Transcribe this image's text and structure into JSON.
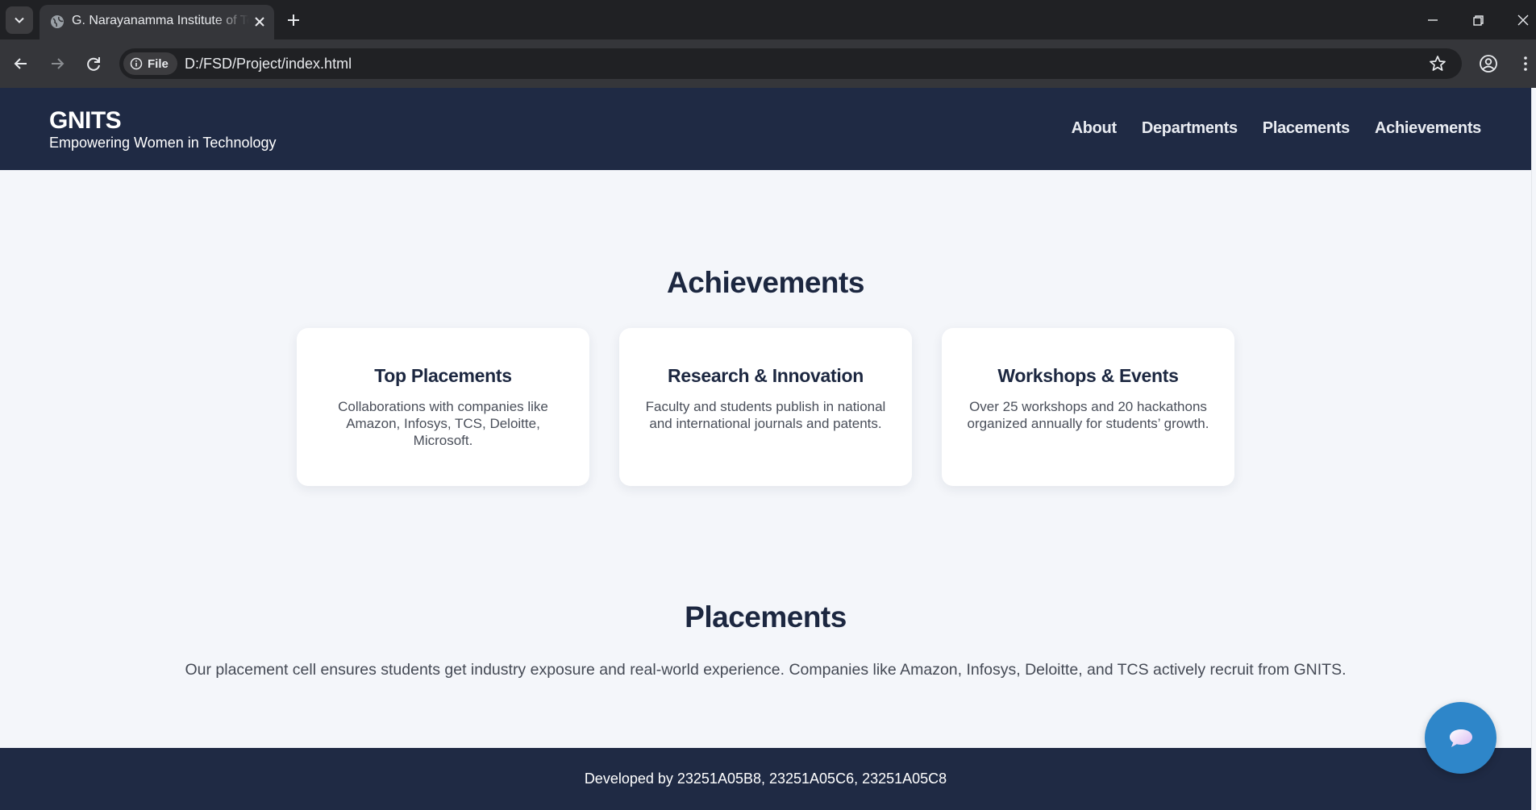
{
  "browser": {
    "tab_title": "G. Narayanamma Institute of Technology",
    "chip_label": "File",
    "url": "D:/FSD/Project/index.html"
  },
  "site": {
    "brand_name": "GNITS",
    "tagline": "Empowering Women in Technology",
    "nav": [
      "About",
      "Departments",
      "Placements",
      "Achievements"
    ]
  },
  "achievements": {
    "title": "Achievements",
    "cards": [
      {
        "title": "Top Placements",
        "text": "Collaborations with companies like Amazon, Infosys, TCS, Deloitte, Microsoft."
      },
      {
        "title": "Research & Innovation",
        "text": "Faculty and students publish in national and international journals and patents."
      },
      {
        "title": "Workshops & Events",
        "text": "Over 25 workshops and 20 hackathons organized annually for students’ growth."
      }
    ]
  },
  "placements": {
    "title": "Placements",
    "text": "Our placement cell ensures students get industry exposure and real-world experience. Companies like Amazon, Infosys, Deloitte, and TCS actively recruit from GNITS."
  },
  "footer": {
    "text": "Developed by 23251A05B8, 23251A05C6, 23251A05C8"
  },
  "colors": {
    "header_bg": "#1f2a44",
    "page_bg": "#f4f6fa",
    "chat_button": "#2e86c9"
  },
  "icons": [
    "tab-search-icon",
    "globe-icon",
    "close-icon",
    "plus-icon",
    "minimize-icon",
    "restore-icon",
    "window-close-icon",
    "back-arrow-icon",
    "forward-arrow-icon",
    "reload-icon",
    "info-icon",
    "star-icon",
    "profile-icon",
    "kebab-menu-icon",
    "chat-bubble-icon"
  ]
}
